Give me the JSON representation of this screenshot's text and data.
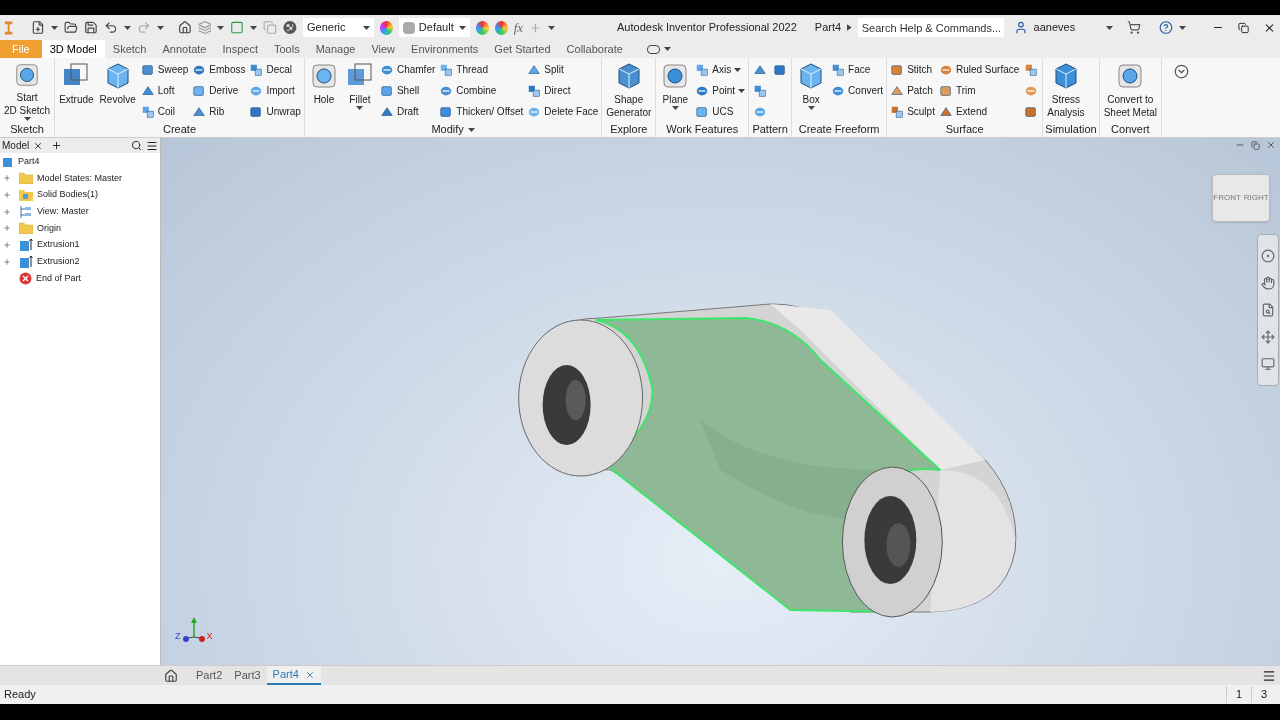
{
  "title_bar": {
    "appearance": [
      {
        "label": "Generic"
      },
      {
        "label": "Default"
      }
    ],
    "formula": "fx",
    "app_title": "Autodesk Inventor Professional 2022",
    "document": "Part4",
    "search": {
      "placeholder": "Search Help & Commands..."
    },
    "user": "aaneves"
  },
  "tabs": [
    {
      "label": "File",
      "kind": "file",
      "selected": false
    },
    {
      "label": "3D Model",
      "kind": "tab",
      "selected": true
    },
    {
      "label": "Sketch",
      "kind": "tab",
      "selected": false
    },
    {
      "label": "Annotate",
      "kind": "tab",
      "selected": false
    },
    {
      "label": "Inspect",
      "kind": "tab",
      "selected": false
    },
    {
      "label": "Tools",
      "kind": "tab",
      "selected": false
    },
    {
      "label": "Manage",
      "kind": "tab",
      "selected": false
    },
    {
      "label": "View",
      "kind": "tab",
      "selected": false
    },
    {
      "label": "Environments",
      "kind": "tab",
      "selected": false
    },
    {
      "label": "Get Started",
      "kind": "tab",
      "selected": false
    },
    {
      "label": "Collaborate",
      "kind": "tab",
      "selected": false
    }
  ],
  "ribbon": {
    "panels": [
      {
        "title": "Sketch",
        "menu": false,
        "groups": [
          {
            "kind": "large",
            "label": "Start\n2D Sketch",
            "menu": true
          }
        ]
      },
      {
        "title": "Create",
        "menu": false,
        "groups": [
          {
            "kind": "large",
            "label": "Extrude",
            "menu": false
          },
          {
            "kind": "large",
            "label": "Revolve",
            "menu": false
          },
          {
            "kind": "column",
            "tools": [
              {
                "kind": "labeled",
                "label": "Sweep",
                "menu": false
              },
              {
                "kind": "labeled",
                "label": "Loft",
                "menu": false
              },
              {
                "kind": "labeled",
                "label": "Coil",
                "menu": false
              }
            ]
          },
          {
            "kind": "column",
            "tools": [
              {
                "kind": "labeled",
                "label": "Emboss",
                "menu": false
              },
              {
                "kind": "labeled",
                "label": "Derive",
                "menu": false
              },
              {
                "kind": "labeled",
                "label": "Rib",
                "menu": false
              }
            ]
          },
          {
            "kind": "column",
            "tools": [
              {
                "kind": "labeled",
                "label": "Decal",
                "menu": false
              },
              {
                "kind": "labeled",
                "label": "Import",
                "menu": false
              },
              {
                "kind": "labeled",
                "label": "Unwrap",
                "menu": false
              }
            ]
          }
        ]
      },
      {
        "title": "Modify",
        "menu": true,
        "groups": [
          {
            "kind": "large",
            "label": "Hole",
            "menu": false
          },
          {
            "kind": "large",
            "label": "Fillet",
            "menu": true
          },
          {
            "kind": "column",
            "tools": [
              {
                "kind": "labeled",
                "label": "Chamfer",
                "menu": false
              },
              {
                "kind": "labeled",
                "label": "Shell",
                "menu": false
              },
              {
                "kind": "labeled",
                "label": "Draft",
                "menu": false
              }
            ]
          },
          {
            "kind": "column",
            "tools": [
              {
                "kind": "labeled",
                "label": "Thread",
                "menu": false
              },
              {
                "kind": "labeled",
                "label": "Combine",
                "menu": false
              },
              {
                "kind": "labeled",
                "label": "Thicken/ Offset",
                "menu": false
              }
            ]
          },
          {
            "kind": "column",
            "tools": [
              {
                "kind": "labeled",
                "label": "Split",
                "menu": false
              },
              {
                "kind": "labeled",
                "label": "Direct",
                "menu": false
              },
              {
                "kind": "labeled",
                "label": "Delete Face",
                "menu": false
              }
            ]
          }
        ]
      },
      {
        "title": "Explore",
        "menu": false,
        "groups": [
          {
            "kind": "large",
            "label": "Shape\nGenerator",
            "menu": false
          }
        ]
      },
      {
        "title": "Work Features",
        "menu": false,
        "groups": [
          {
            "kind": "large",
            "label": "Plane",
            "menu": true
          },
          {
            "kind": "column",
            "tools": [
              {
                "kind": "labeled",
                "label": "Axis",
                "menu": true
              },
              {
                "kind": "labeled",
                "label": "Point",
                "menu": true
              },
              {
                "kind": "labeled",
                "label": "UCS",
                "menu": false
              }
            ]
          }
        ]
      },
      {
        "title": "Pattern",
        "menu": false,
        "groups": [
          {
            "kind": "column",
            "tools": [
              {
                "kind": "icon",
                "menu": false
              },
              {
                "kind": "icon",
                "menu": false
              },
              {
                "kind": "icon",
                "menu": false
              }
            ]
          },
          {
            "kind": "column",
            "tools": [
              {
                "kind": "icon",
                "menu": false
              }
            ]
          }
        ]
      },
      {
        "title": "Create Freeform",
        "menu": false,
        "groups": [
          {
            "kind": "large",
            "label": "Box",
            "menu": true
          },
          {
            "kind": "column",
            "tools": [
              {
                "kind": "labeled",
                "label": "Face",
                "menu": false
              },
              {
                "kind": "labeled",
                "label": "Convert",
                "menu": false
              }
            ]
          }
        ]
      },
      {
        "title": "Surface",
        "menu": false,
        "groups": [
          {
            "kind": "column",
            "tools": [
              {
                "kind": "labeled",
                "label": "Stitch",
                "menu": false
              },
              {
                "kind": "labeled",
                "label": "Patch",
                "menu": false
              },
              {
                "kind": "labeled",
                "label": "Sculpt",
                "menu": false
              }
            ]
          },
          {
            "kind": "column",
            "tools": [
              {
                "kind": "labeled",
                "label": "Ruled Surface",
                "menu": false
              },
              {
                "kind": "labeled",
                "label": "Trim",
                "menu": false
              },
              {
                "kind": "labeled",
                "label": "Extend",
                "menu": false
              }
            ]
          },
          {
            "kind": "column",
            "tools": [
              {
                "kind": "icon",
                "menu": false
              },
              {
                "kind": "icon",
                "menu": false
              },
              {
                "kind": "icon",
                "menu": false
              }
            ]
          }
        ]
      },
      {
        "title": "Simulation",
        "menu": false,
        "groups": [
          {
            "kind": "large",
            "label": "Stress\nAnalysis",
            "menu": false
          }
        ]
      },
      {
        "title": "Convert",
        "menu": false,
        "groups": [
          {
            "kind": "large",
            "label": "Convert to\nSheet Metal",
            "menu": false
          }
        ]
      }
    ]
  },
  "browser": {
    "tab": "Model",
    "root": "Part4",
    "items": [
      {
        "label": "Model States: Master",
        "kind": "folder",
        "expandable": true
      },
      {
        "label": "Solid Bodies(1)",
        "kind": "bodies",
        "expandable": true
      },
      {
        "label": "View: Master",
        "kind": "view",
        "expandable": true
      },
      {
        "label": "Origin",
        "kind": "folder",
        "expandable": true
      },
      {
        "label": "Extrusion1",
        "kind": "extrusion",
        "expandable": true
      },
      {
        "label": "Extrusion2",
        "kind": "extrusion",
        "expandable": true
      },
      {
        "label": "End of Part",
        "kind": "end",
        "expandable": false
      }
    ]
  },
  "viewport": {
    "view_cube": [
      "FRONT",
      "RIGHT"
    ],
    "axes": [
      "Z",
      "X"
    ]
  },
  "doc_tabs": [
    {
      "label": "Part2",
      "selected": false
    },
    {
      "label": "Part3",
      "selected": false
    },
    {
      "label": "Part4",
      "selected": true
    }
  ],
  "status_bar": {
    "text": "Ready",
    "values": [
      "1",
      "3"
    ]
  }
}
